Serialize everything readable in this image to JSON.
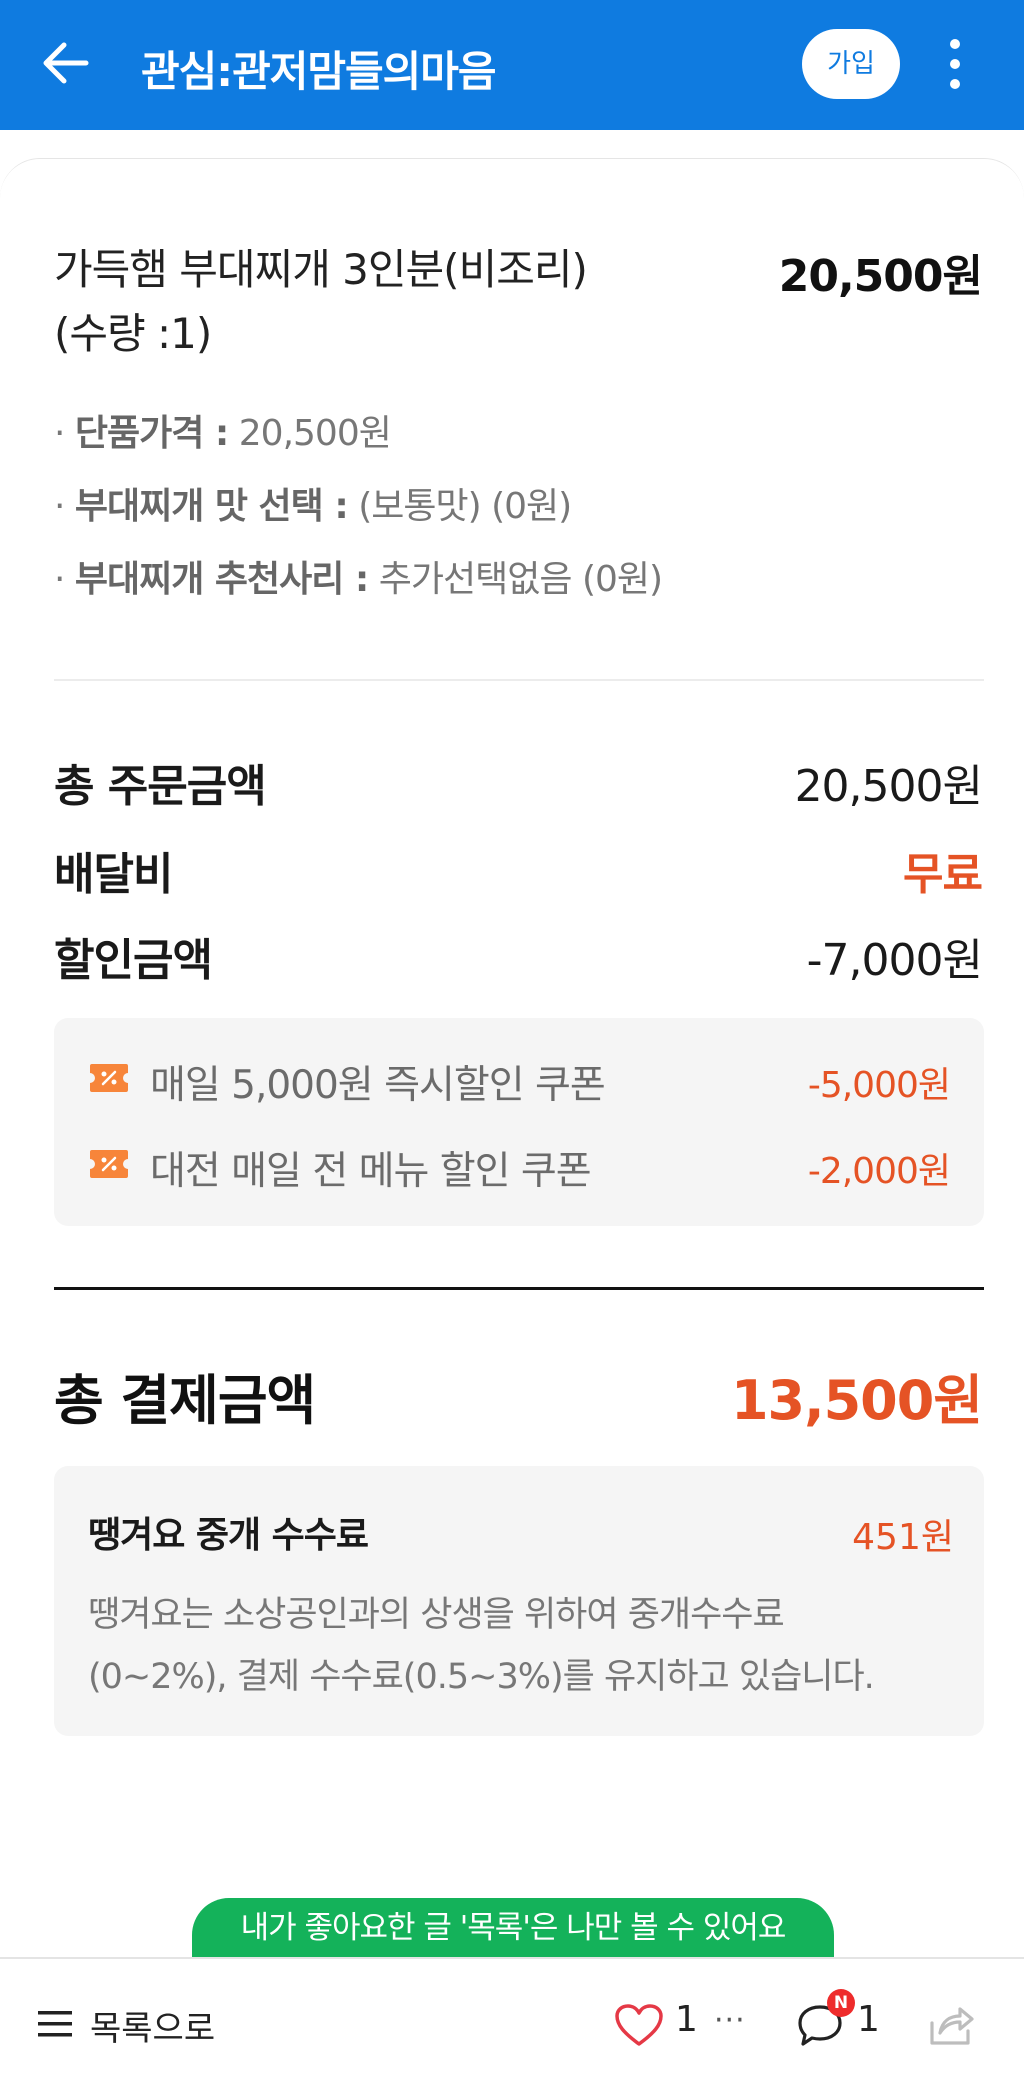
{
  "appbar": {
    "title": "관심:관저맘들의마음",
    "join_label": "가입"
  },
  "order": {
    "item_name": "가득햄 부대찌개 3인분(비조리)",
    "item_qty": "(수량 :1)",
    "item_price": "20,500원",
    "options": [
      {
        "key": "단품가격 :",
        "value": "20,500원"
      },
      {
        "key": "부대찌개 맛 선택 :",
        "value": "(보통맛) (0원)"
      },
      {
        "key": "부대찌개 추천사리 :",
        "value": "추가선택없음 (0원)"
      }
    ]
  },
  "summary": {
    "total_order_label": "총 주문금액",
    "total_order_value": "20,500원",
    "delivery_label": "배달비",
    "delivery_value": "무료",
    "discount_label": "할인금액",
    "discount_value": "-7,000원"
  },
  "coupons": [
    {
      "name": "매일 5,000원 즉시할인 쿠폰",
      "amount": "-5,000원"
    },
    {
      "name": "대전 매일 전 메뉴 할인 쿠폰",
      "amount": "-2,000원"
    }
  ],
  "payment": {
    "label": "총 결제금액",
    "value": "13,500원"
  },
  "fee": {
    "title": "땡겨요 중개 수수료",
    "amount": "451원",
    "desc_line1": "땡겨요는 소상공인과의 상생을 위하여 중개수수료",
    "desc_line2": "(0~2%), 결제 수수료(0.5~3%)를 유지하고 있습니다."
  },
  "toast": {
    "text": "내가 좋아요한 글 '목록'은 나만 볼 수 있어요"
  },
  "bottombar": {
    "list_label": "목록으로",
    "likes": "1",
    "dots": "···",
    "new_badge": "N",
    "comments": "1"
  },
  "colors": {
    "appbar": "#0f7be0",
    "accent_orange": "#e55325",
    "toast_green": "#14b25a",
    "coupon_icon": "#f7853a"
  },
  "icons": [
    "back-arrow-icon",
    "more-vertical-icon",
    "coupon-ticket-icon",
    "menu-icon",
    "heart-icon",
    "comment-icon",
    "share-icon"
  ]
}
